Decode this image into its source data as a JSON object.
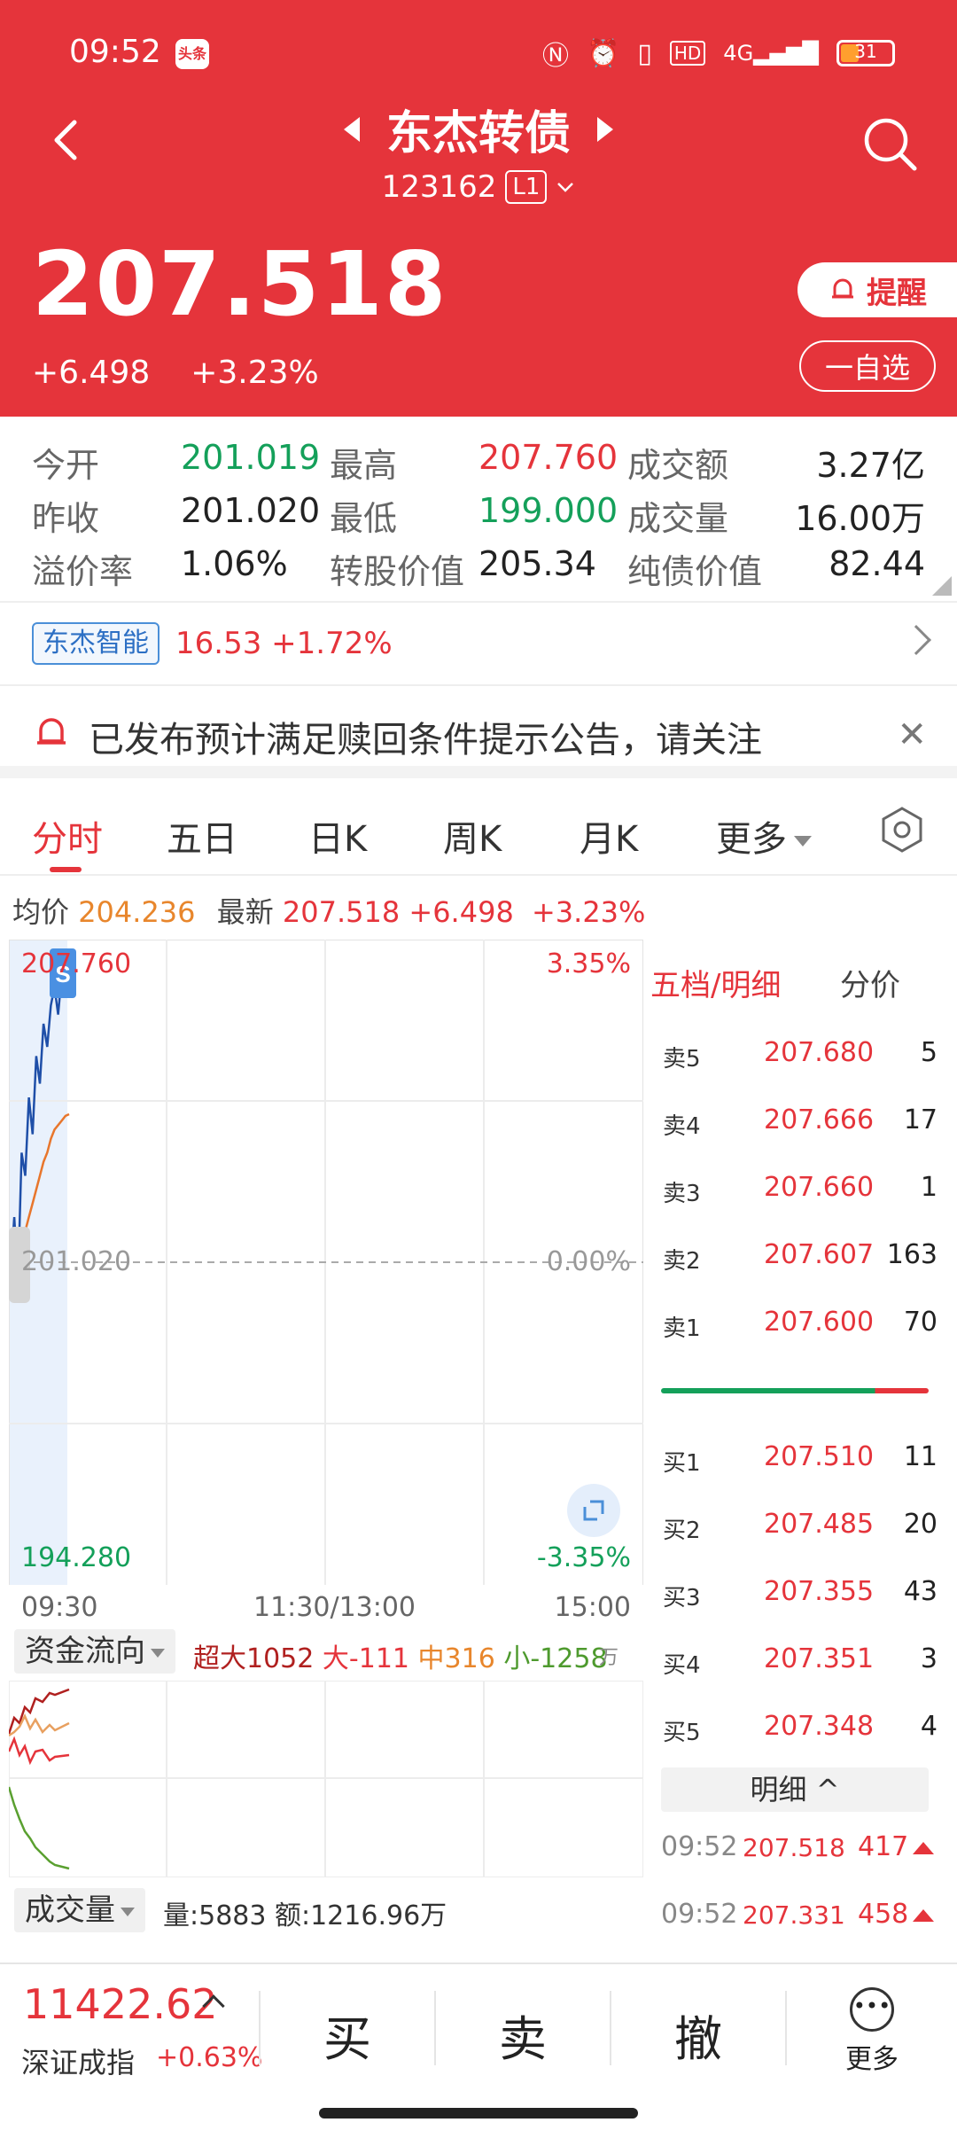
{
  "status_bar": {
    "time": "09:52",
    "app_badge": "头条",
    "icons": [
      "nfc-icon",
      "alarm-icon",
      "vibrate-icon",
      "hd-icon",
      "signal-4g-icon"
    ],
    "battery": "31"
  },
  "header": {
    "title": "东杰转债",
    "code": "123162",
    "level": "L1",
    "price": "207.518",
    "change": "+6.498",
    "change_pct": "+3.23%",
    "remind_label": "提醒",
    "watchlist_label": "一自选"
  },
  "stats": {
    "open_label": "今开",
    "open": "201.019",
    "high_label": "最高",
    "high": "207.760",
    "amount_label": "成交额",
    "amount": "3.27亿",
    "prev_label": "昨收",
    "prev": "201.020",
    "low_label": "最低",
    "low": "199.000",
    "volume_label": "成交量",
    "volume": "16.00万",
    "premium_label": "溢价率",
    "premium": "1.06%",
    "conv_label": "转股价值",
    "conv": "205.34",
    "bond_label": "纯债价值",
    "bond": "82.44"
  },
  "related": {
    "name": "东杰智能",
    "quote": "16.53 +1.72%"
  },
  "notice": {
    "text": "已发布预计满足赎回条件提示公告，请关注"
  },
  "tabs": {
    "items": [
      "分时",
      "五日",
      "日K",
      "周K",
      "月K",
      "更多"
    ]
  },
  "avg_row": {
    "avg_label": "均价",
    "avg": "204.236",
    "last_label": "最新",
    "last": "207.518",
    "chg": "+6.498",
    "pct": "+3.23%"
  },
  "chart_data": {
    "type": "line",
    "title": "",
    "x_ticks": [
      "09:30",
      "11:30/13:00",
      "15:00"
    ],
    "y_top_label": "207.760",
    "y_top_pct": "3.35%",
    "y_mid_label": "201.020",
    "y_mid_pct": "0.00%",
    "y_bottom_label": "194.280",
    "y_bottom_pct": "-3.35%",
    "ylim": [
      194.28,
      207.76
    ],
    "series": [
      {
        "values": [
          200.8,
          202.0,
          200.6,
          203.4,
          202.9,
          204.6,
          203.8,
          205.5,
          204.9,
          206.2,
          205.7,
          206.6,
          207.0,
          206.4,
          207.3,
          207.1,
          207.52
        ]
      },
      {
        "values": [
          200.9,
          201.2,
          201.0,
          201.3,
          201.7,
          202.0,
          202.3,
          202.6,
          202.9,
          203.2,
          203.4,
          203.7,
          203.9,
          204.0,
          204.1,
          204.2,
          204.236
        ]
      }
    ],
    "grid": true
  },
  "orderbook": {
    "tab_label": "五档/明细",
    "tab2_label": "分价",
    "asks": [
      {
        "label": "卖5",
        "price": "207.680",
        "vol": "5"
      },
      {
        "label": "卖4",
        "price": "207.666",
        "vol": "17"
      },
      {
        "label": "卖3",
        "price": "207.660",
        "vol": "1"
      },
      {
        "label": "卖2",
        "price": "207.607",
        "vol": "163"
      },
      {
        "label": "卖1",
        "price": "207.600",
        "vol": "70"
      }
    ],
    "bids": [
      {
        "label": "买1",
        "price": "207.510",
        "vol": "11"
      },
      {
        "label": "买2",
        "price": "207.485",
        "vol": "20"
      },
      {
        "label": "买3",
        "price": "207.355",
        "vol": "43"
      },
      {
        "label": "买4",
        "price": "207.351",
        "vol": "3"
      },
      {
        "label": "买5",
        "price": "207.348",
        "vol": "4"
      }
    ],
    "buy_ratio": 0.8,
    "detail_label": "明细",
    "ticks": [
      {
        "time": "09:52",
        "price": "207.518",
        "vol": "417"
      },
      {
        "time": "09:52",
        "price": "207.331",
        "vol": "458"
      }
    ]
  },
  "money_flow": {
    "label": "资金流向",
    "super": "超大1052",
    "large": "大-111",
    "mid": "中316",
    "small": "小-1258",
    "unit": "万"
  },
  "volume": {
    "label": "成交量",
    "values": "量:5883 额:1216.96万"
  },
  "bottom": {
    "index_value": "11422.62",
    "index_name": "深证成指",
    "index_chg": "+0.63%",
    "buy": "买",
    "sell": "卖",
    "cancel": "撤",
    "more": "更多"
  }
}
